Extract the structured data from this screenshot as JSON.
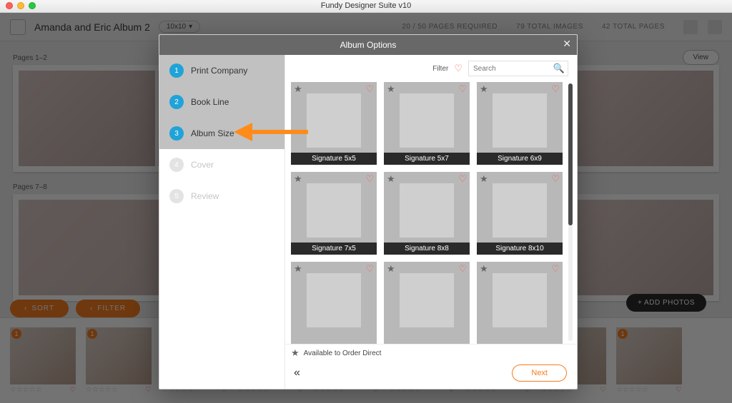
{
  "window": {
    "title": "Fundy Designer Suite v10"
  },
  "toolbar": {
    "album_name": "Amanda and Eric Album 2",
    "size_pill": "10x10",
    "status_text": "20 / 50 pages required",
    "total_images_label": "79  TOTAL IMAGES",
    "total_pages_label": "42  TOTAL PAGES"
  },
  "buttons": {
    "sort": "SORT",
    "filter": "FILTER",
    "view": "View",
    "add_photos": "+ ADD PHOTOS"
  },
  "spread_labels": {
    "a": "Pages 1–2",
    "b": "Pages 7–8"
  },
  "modal": {
    "title": "Album Options",
    "steps": [
      {
        "num": "1",
        "label": "Print Company"
      },
      {
        "num": "2",
        "label": "Book Line"
      },
      {
        "num": "3",
        "label": "Album Size"
      },
      {
        "num": "4",
        "label": "Cover"
      },
      {
        "num": "5",
        "label": "Review"
      }
    ],
    "filter_label": "Filter",
    "search_placeholder": "Search",
    "options": [
      "Signature 5x5",
      "Signature 5x7",
      "Signature 6x9",
      "Signature 7x5",
      "Signature 8x8",
      "Signature 8x10",
      "",
      "",
      ""
    ],
    "legend_text": "Available to Order Direct",
    "next_label": "Next",
    "back_glyph": "«"
  },
  "filmstrip_badge": "1"
}
